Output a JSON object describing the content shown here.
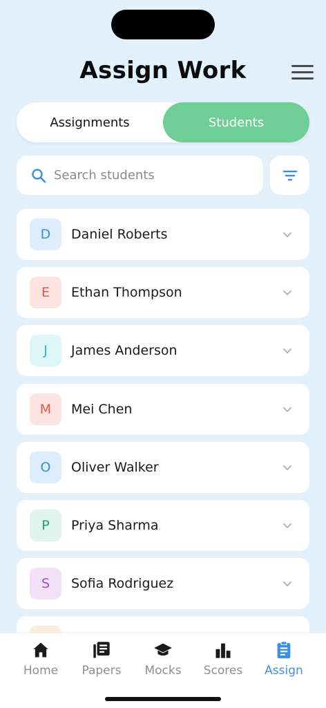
{
  "header": {
    "title": "Assign Work"
  },
  "segments": {
    "assignments": "Assignments",
    "students": "Students"
  },
  "search": {
    "placeholder": "Search students"
  },
  "students": [
    {
      "initial": "D",
      "name": "Daniel Roberts",
      "bg": "#deedfb",
      "fg": "#3a8fd6"
    },
    {
      "initial": "E",
      "name": "Ethan Thompson",
      "bg": "#fde3e1",
      "fg": "#e0574c"
    },
    {
      "initial": "J",
      "name": "James Anderson",
      "bg": "#dff6f8",
      "fg": "#2fb4c2"
    },
    {
      "initial": "M",
      "name": "Mei Chen",
      "bg": "#fde3e1",
      "fg": "#e0574c"
    },
    {
      "initial": "O",
      "name": "Oliver Walker",
      "bg": "#deedfb",
      "fg": "#3a8fd6"
    },
    {
      "initial": "P",
      "name": "Priya Sharma",
      "bg": "#dff4ec",
      "fg": "#2a9d7a"
    },
    {
      "initial": "S",
      "name": "Sofia Rodriguez",
      "bg": "#f3e2f7",
      "fg": "#a54cbf"
    },
    {
      "initial": "",
      "name": "",
      "bg": "#fdecd9",
      "fg": "#e0904c"
    }
  ],
  "tabs": [
    {
      "label": "Home",
      "icon": "home-icon"
    },
    {
      "label": "Papers",
      "icon": "papers-icon"
    },
    {
      "label": "Mocks",
      "icon": "graduation-cap-icon"
    },
    {
      "label": "Scores",
      "icon": "bar-chart-icon"
    },
    {
      "label": "Assign",
      "icon": "clipboard-icon"
    }
  ],
  "colors": {
    "accent": "#6fce96",
    "active_tab": "#3d8fe3",
    "background": "#e3f1fc"
  }
}
